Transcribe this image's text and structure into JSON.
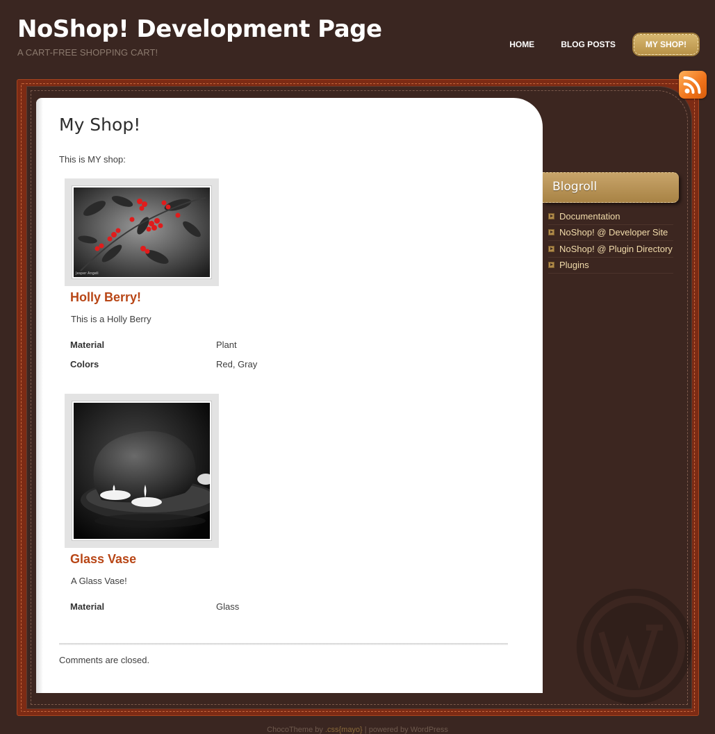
{
  "header": {
    "title": "NoShop! Development Page",
    "tagline": "A CART-FREE SHOPPING CART!"
  },
  "nav": {
    "items": [
      {
        "label": "HOME",
        "active": false
      },
      {
        "label": "BLOG POSTS",
        "active": false
      },
      {
        "label": "MY SHOP!",
        "active": true
      }
    ]
  },
  "rss": {
    "icon": "rss-icon"
  },
  "main": {
    "heading": "My Shop!",
    "intro": "This is MY shop:",
    "products": [
      {
        "name": "Holly Berry!",
        "description": "This is a Holly Berry",
        "image_credit": "Jesper Angeli",
        "attributes": [
          {
            "key": "Material",
            "value": "Plant"
          },
          {
            "key": "Colors",
            "value": "Red, Gray"
          }
        ]
      },
      {
        "name": "Glass Vase",
        "description": "A Glass Vase!",
        "attributes": [
          {
            "key": "Material",
            "value": "Glass"
          }
        ]
      }
    ],
    "comments_status": "Comments are closed."
  },
  "sidebar": {
    "widget_title": "Blogroll",
    "links": [
      "Documentation",
      "NoShop! @ Developer Site",
      "NoShop! @ Plugin Directory",
      "Plugins"
    ]
  },
  "footer": {
    "prefix": "ChocoTheme by ",
    "author": ".css{mayo}",
    "suffix": " | powered by WordPress"
  },
  "colors": {
    "background": "#3a2621",
    "frame": "#7d2b14",
    "accent_gold": "#c8a46a",
    "product_title": "#b84616",
    "link": "#f2dcab"
  }
}
